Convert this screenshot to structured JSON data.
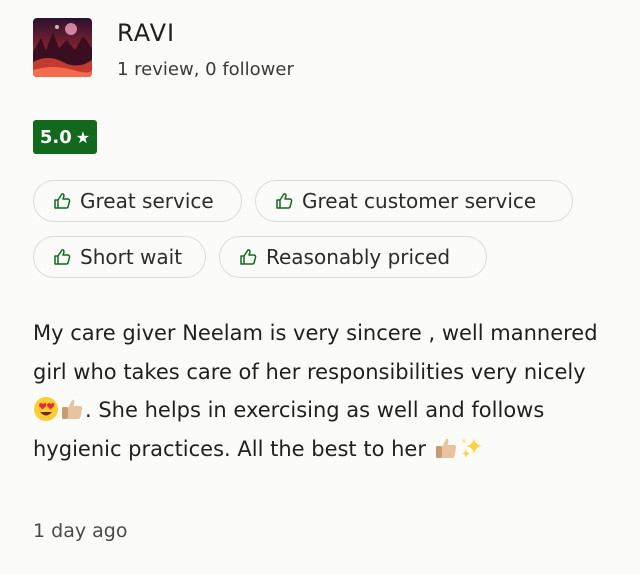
{
  "reviewer": {
    "name": "RAVI",
    "meta": "1 review, 0 follower"
  },
  "rating": {
    "value": "5.0",
    "star": "★"
  },
  "tags": [
    {
      "label": "Great service"
    },
    {
      "label": "Great customer service"
    },
    {
      "label": "Short wait"
    },
    {
      "label": "Reasonably priced"
    }
  ],
  "review": {
    "part1": "My care giver Neelam is very sincere , well mannered girl who takes care of her responsibilities very nicely",
    "part2": ". She helps in exercising as well and follows hygienic practices. All the best to her",
    "emojis": [
      "heart-eyes-emoji",
      "thumbs-up-emoji",
      "thumbs-up-emoji",
      "sparkles-emoji"
    ]
  },
  "date": "1 day ago",
  "colors": {
    "rating_badge": "#12691e",
    "background": "#fbfbf9",
    "tag_border": "#dcdcdc"
  }
}
